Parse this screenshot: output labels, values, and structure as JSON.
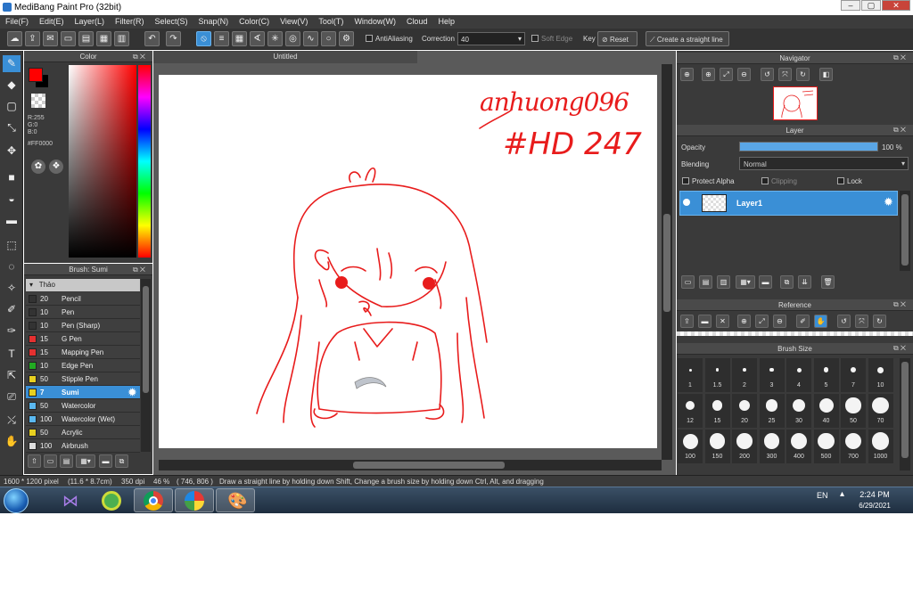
{
  "window": {
    "title": "MediBang Paint Pro (32bit)"
  },
  "menu": [
    "File(F)",
    "Edit(E)",
    "Layer(L)",
    "Filter(R)",
    "Select(S)",
    "Snap(N)",
    "Color(C)",
    "View(V)",
    "Tool(T)",
    "Window(W)",
    "Cloud",
    "Help"
  ],
  "toolbar": {
    "antialiasing_label": "AntiAliasing",
    "correction_label": "Correction",
    "correction_value": "40",
    "soft_edge_label": "Soft Edge",
    "key_label": "Key",
    "reset_label": "Reset",
    "straight_line_label": "Create a straight line"
  },
  "color_panel": {
    "title": "Color",
    "r": "R:255",
    "g": "G:0",
    "b": "B:0",
    "hex": "#FF0000",
    "foreground": "#ff0000"
  },
  "canvas": {
    "tab_title": "Untitled",
    "signature_line1": "anhuong096",
    "signature_line2": "#HD 247"
  },
  "brush_panel": {
    "title": "Brush: Sumi",
    "group": "Thảo",
    "items": [
      {
        "size": "20",
        "name": "Pencil",
        "color": "#333333"
      },
      {
        "size": "10",
        "name": "Pen",
        "color": "#333333"
      },
      {
        "size": "10",
        "name": "Pen (Sharp)",
        "color": "#333333"
      },
      {
        "size": "15",
        "name": "G Pen",
        "color": "#e53030"
      },
      {
        "size": "15",
        "name": "Mapping Pen",
        "color": "#e53030"
      },
      {
        "size": "10",
        "name": "Edge Pen",
        "color": "#22aa22"
      },
      {
        "size": "50",
        "name": "Stipple Pen",
        "color": "#e8d020"
      },
      {
        "size": "7",
        "name": "Sumi",
        "color": "#e8d020"
      },
      {
        "size": "50",
        "name": "Watercolor",
        "color": "#5ab8f0"
      },
      {
        "size": "100",
        "name": "Watercolor (Wet)",
        "color": "#5ab8f0"
      },
      {
        "size": "50",
        "name": "Acrylic",
        "color": "#e8d020"
      },
      {
        "size": "100",
        "name": "Airbrush",
        "color": "#dddddd"
      }
    ]
  },
  "navigator": {
    "title": "Navigator"
  },
  "layer_panel": {
    "title": "Layer",
    "opacity_label": "Opacity",
    "opacity_value": "100 %",
    "opacity_level": 1.0,
    "blending_label": "Blending",
    "blending_value": "Normal",
    "protect_alpha": "Protect Alpha",
    "clipping": "Clipping",
    "lock": "Lock",
    "layer_name": "Layer1"
  },
  "reference": {
    "title": "Reference"
  },
  "brush_size": {
    "title": "Brush Size",
    "sizes": [
      "1",
      "1.5",
      "2",
      "3",
      "4",
      "5",
      "7",
      "10",
      "12",
      "15",
      "20",
      "25",
      "30",
      "40",
      "50",
      "70",
      "100",
      "150",
      "200",
      "300",
      "400",
      "500",
      "700",
      "1000"
    ]
  },
  "status": {
    "dimensions": "1600 * 1200 pixel",
    "physical": "(11.6 * 8.7cm)",
    "dpi": "350 dpi",
    "zoom": "46 %",
    "cursor": "( 746, 806 )",
    "hint": "Draw a straight line by holding down Shift, Change a brush size by holding down Ctrl, Alt, and dragging"
  },
  "taskbar": {
    "lang": "EN",
    "time": "2:24 PM",
    "date": "6/29/2021"
  }
}
